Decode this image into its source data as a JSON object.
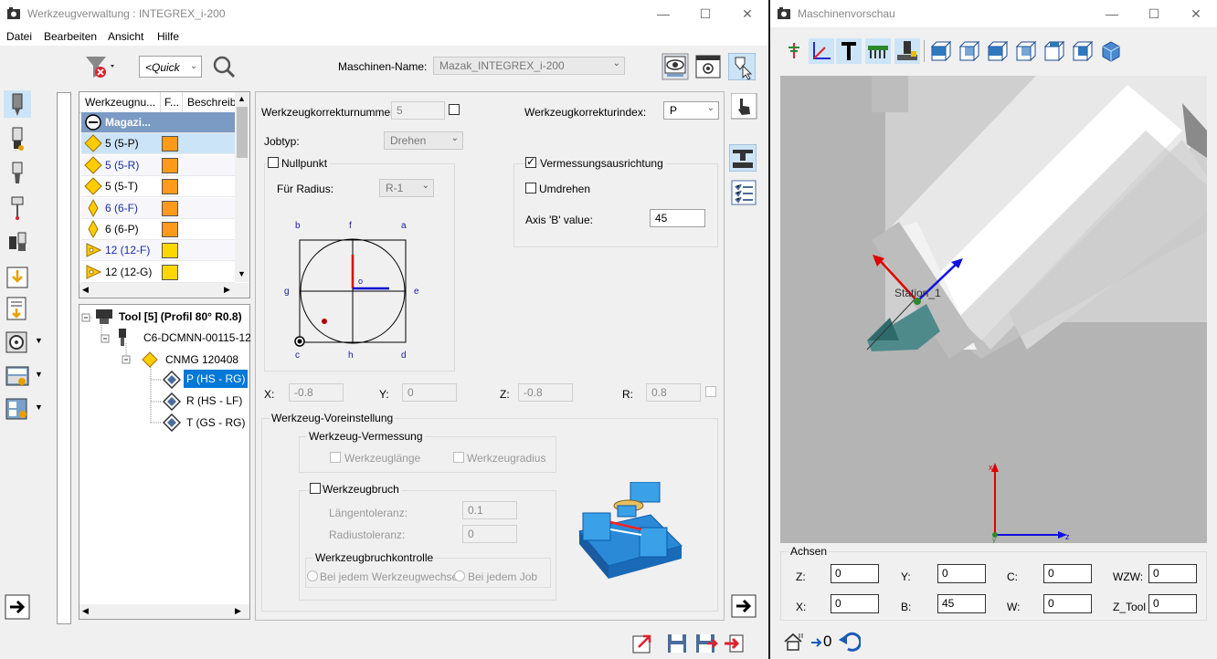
{
  "colors": {
    "accent": "#0078d7",
    "selection": "#cce4f7",
    "orange": "#ff9a1a",
    "yellow": "#ffd700",
    "viewport_bg": "#b4b4b4",
    "tool_teal": "#4f8a8b"
  },
  "left_window": {
    "title": "Werkzeugverwaltung : INTEGREX_i-200",
    "menu": [
      "Datei",
      "Bearbeiten",
      "Ansicht",
      "Hilfe"
    ],
    "quick_search": "<Quick",
    "machine_label": "Maschinen-Name:",
    "machine_value": "Mazak_INTEGREX_i-200",
    "table": {
      "headers": [
        "Werkzeugnu...",
        "F...",
        "Beschreib"
      ],
      "rows": [
        {
          "name": "Magazi...",
          "color": "",
          "style": "header"
        },
        {
          "name": "5 (5-P)",
          "color": "#ff9a1a",
          "style": "selected"
        },
        {
          "name": "5 (5-R)",
          "color": "#ff9a1a",
          "style": "blue"
        },
        {
          "name": "5 (5-T)",
          "color": "#ff9a1a",
          "style": "normal"
        },
        {
          "name": "6 (6-F)",
          "color": "#ff9a1a",
          "style": "blue"
        },
        {
          "name": "6 (6-P)",
          "color": "#ff9a1a",
          "style": "normal"
        },
        {
          "name": "12 (12-F)",
          "color": "#ffd700",
          "style": "blue"
        },
        {
          "name": "12 (12-G)",
          "color": "#ffd700",
          "style": "normal"
        }
      ]
    },
    "tree": {
      "root": "Tool [5] (Profil 80° R0.8)",
      "holder": "C6-DCMNN-00115-12",
      "insert": "CNMG 120408",
      "cutters": [
        "P (HS - RG)",
        "R (HS - LF)",
        "T (GS - RG)"
      ]
    },
    "form": {
      "korr_num_label": "Werkzeugkorrekturnummer:",
      "korr_num_value": "5",
      "korr_index_label": "Werkzeugkorrekturindex:",
      "korr_index_value": "P",
      "jobtyp_label": "Jobtyp:",
      "jobtyp_value": "Drehen",
      "nullpunkt_label": "Nullpunkt",
      "fuer_radius_label": "Für Radius:",
      "fuer_radius_value": "R-1",
      "vermessung_label": "Vermessungsausrichtung",
      "umdrehen_label": "Umdrehen",
      "axis_b_label": "Axis 'B' value:",
      "axis_b_value": "45",
      "diagram_letters": {
        "b": "b",
        "f": "f",
        "a": "a",
        "g": "g",
        "e": "e",
        "c": "c",
        "h": "h",
        "d": "d",
        "o": "o"
      },
      "x_label": "X:",
      "x_value": "-0.8",
      "y_label": "Y:",
      "y_value": "0",
      "z_label": "Z:",
      "z_value": "-0.8",
      "r_label": "R:",
      "r_value": "0.8",
      "voreinstellung_title": "Werkzeug-Voreinstellung",
      "vermessung_group_title": "Werkzeug-Vermessung",
      "werkzeuglaenge_label": "Werkzeuglänge",
      "werkzeugradius_label": "Werkzeugradius",
      "werkzeugbruch_label": "Werkzeugbruch",
      "laengentoleranz_label": "Längentoleranz:",
      "laengentoleranz_value": "0.1",
      "radiustoleranz_label": "Radiustoleranz:",
      "radiustoleranz_value": "0",
      "bruchkontrolle_title": "Werkzeugbruchkontrolle",
      "radio1_label": "Bei jedem Werkzeugwechsel",
      "radio2_label": "Bei jedem Job"
    }
  },
  "right_window": {
    "title": "Maschinenvorschau",
    "overlay_label": "Station_1",
    "axis_labels": {
      "x": "x",
      "y": "y",
      "z": "z"
    },
    "achsen_title": "Achsen",
    "axes": [
      {
        "label": "Z:",
        "value": "0"
      },
      {
        "label": "Y:",
        "value": "0"
      },
      {
        "label": "C:",
        "value": "0"
      },
      {
        "label": "WZW:",
        "value": "0"
      },
      {
        "label": "X:",
        "value": "0"
      },
      {
        "label": "B:",
        "value": "45"
      },
      {
        "label": "W:",
        "value": "0"
      },
      {
        "label": "Z_Tool",
        "value": "0"
      }
    ],
    "counter": "0"
  },
  "controls": {
    "minimize": "—",
    "maximize": "☐",
    "close": "✕"
  }
}
